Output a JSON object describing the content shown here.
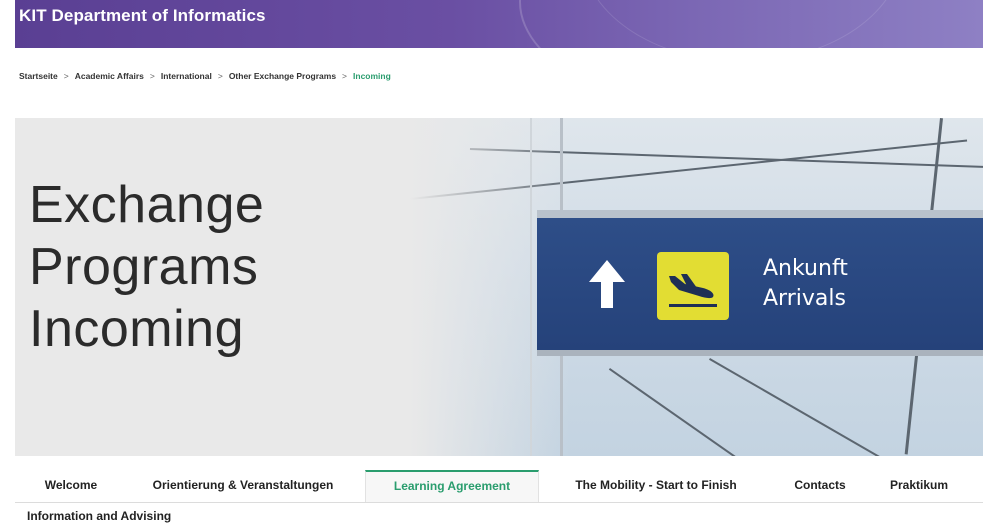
{
  "header": {
    "site_title": "KIT Department of Informatics"
  },
  "breadcrumb": {
    "items": [
      "Startseite",
      "Academic Affairs",
      "International",
      "Other Exchange Programs"
    ],
    "current": "Incoming",
    "separator": ">"
  },
  "hero": {
    "title_lines": [
      "Exchange",
      "Programs",
      "Incoming"
    ],
    "sign_lines": [
      "Ankunft",
      "Arrivals"
    ]
  },
  "tabs": [
    {
      "label": "Welcome"
    },
    {
      "label": "Orientierung & Veranstaltungen"
    },
    {
      "label": "Learning Agreement",
      "active": true
    },
    {
      "label": "The Mobility - Start to Finish"
    },
    {
      "label": "Contacts"
    },
    {
      "label": "Praktikum"
    },
    {
      "label": "Information and Advising"
    }
  ],
  "colors": {
    "header": "#5a3f93",
    "accent": "#2a9d6e",
    "sign": "#2e4e88",
    "sign_icon_bg": "#e2dd33"
  },
  "icons": [
    "arrow-up-icon",
    "airplane-landing-icon"
  ]
}
